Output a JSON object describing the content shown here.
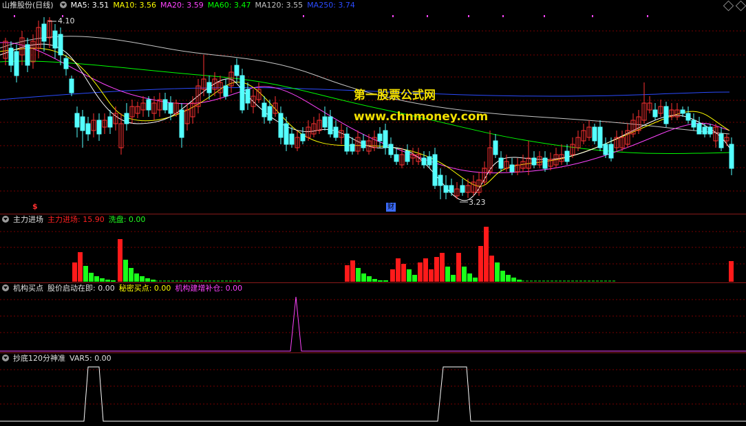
{
  "main": {
    "title": "山推股份(日线)",
    "ma": [
      {
        "label": "MA5: 3.51",
        "color": "#ffffff"
      },
      {
        "label": "MA10: 3.56",
        "color": "#ffff00"
      },
      {
        "label": "MA20: 3.59",
        "color": "#ff44ff"
      },
      {
        "label": "MA60: 3.47",
        "color": "#00ff00"
      },
      {
        "label": "MA120: 3.55",
        "color": "#c0c0c0"
      },
      {
        "label": "MA250: 3.74",
        "color": "#2b4bff"
      }
    ],
    "high_label": "4.10",
    "low_label": "3.23",
    "watermark_cn": "第一股票公式网",
    "watermark_url": "www.chnmoney.com",
    "event_mark": "财",
    "dollar_mark": "$"
  },
  "panel1": {
    "title": "主力进场",
    "items": [
      {
        "label": "主力进场: 15.90",
        "color": "#ff2020"
      },
      {
        "label": "洗盘: 0.00",
        "color": "#20ff20"
      }
    ]
  },
  "panel2": {
    "title": "机构买点",
    "items": [
      {
        "label": "股价启动在即: 0.00",
        "color": "#e0e0e0"
      },
      {
        "label": "秘密买点: 0.00",
        "color": "#ffff00"
      },
      {
        "label": "机构建增补仓: 0.00",
        "color": "#ff44ff"
      }
    ]
  },
  "panel3": {
    "title": "抄底120分神准",
    "items": [
      {
        "label": "VAR5: 0.00",
        "color": "#e0e0e0"
      }
    ]
  },
  "colors": {
    "up": "#ff3232",
    "down": "#54ffff",
    "bar_up": "#ff1a1a",
    "bar_down": "#1aff1a"
  }
}
